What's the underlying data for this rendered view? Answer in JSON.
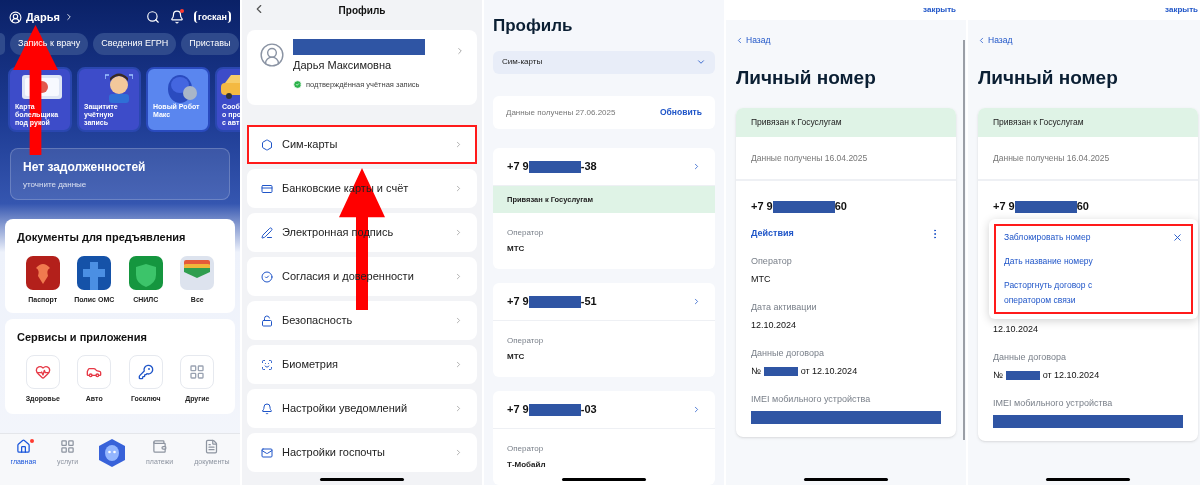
{
  "home": {
    "user": "Дарья",
    "scan": "госкан",
    "chips": [
      "Запись к врачу",
      "Сведения ЕГРН",
      "Приставы"
    ],
    "banners": [
      {
        "kind": "card",
        "lines": [
          "Карта",
          "болельщика",
          "под рукой"
        ]
      },
      {
        "kind": "person",
        "lines": [
          "Защитите",
          "учётную",
          "запись"
        ]
      },
      {
        "kind": "robot",
        "lines": [
          "Новый Робот",
          "Макс"
        ]
      },
      {
        "kind": "car",
        "lines": [
          "Сооб",
          "о про",
          "с авт"
        ]
      }
    ],
    "debt": {
      "title": "Нет задолженностей",
      "subtitle": "уточните данные"
    },
    "documents": {
      "title": "Документы для предъявления",
      "items": [
        {
          "kind": "passport",
          "label": "Паспорт"
        },
        {
          "kind": "oms",
          "label": "Полис ОМС"
        },
        {
          "kind": "snils",
          "label": "СНИЛС"
        },
        {
          "kind": "all",
          "label": "Все"
        }
      ]
    },
    "services": {
      "title": "Сервисы и приложения",
      "items": [
        {
          "kind": "health",
          "label": "Здоровье"
        },
        {
          "kind": "auto",
          "label": "Авто"
        },
        {
          "kind": "key",
          "label": "Госключ"
        },
        {
          "kind": "more",
          "label": "Другие"
        }
      ]
    },
    "nav": [
      {
        "kind": "home",
        "label": "главная",
        "selected": true
      },
      {
        "kind": "services",
        "label": "услуги",
        "selected": false
      },
      {
        "kind": "assistant",
        "selected": false
      },
      {
        "kind": "payments",
        "label": "платежи",
        "selected": false
      },
      {
        "kind": "documents",
        "label": "документы",
        "selected": false
      }
    ]
  },
  "profile": {
    "title": "Профиль",
    "name": "Дарья Максимовна",
    "status": "подтверждённая учётная запись",
    "items": [
      {
        "kind": "sim",
        "label": "Сим-карты",
        "highlighted": true
      },
      {
        "kind": "card",
        "label": "Банковские карты и счёт",
        "highlighted": false
      },
      {
        "kind": "sign",
        "label": "Электронная подпись",
        "highlighted": false
      },
      {
        "kind": "consent",
        "label": "Согласия и доверенности",
        "highlighted": false
      },
      {
        "kind": "lock",
        "label": "Безопасность",
        "highlighted": false
      },
      {
        "kind": "biometry",
        "label": "Биометрия",
        "highlighted": false
      },
      {
        "kind": "bell",
        "label": "Настройки уведомлений",
        "highlighted": false
      },
      {
        "kind": "mail",
        "label": "Настройки госпочты",
        "highlighted": false
      }
    ]
  },
  "sim_list": {
    "title": "Профиль",
    "select": "Сим-карты",
    "received": "Данные получены 27.06.2025",
    "refresh": "Обновить",
    "sims": [
      {
        "prefix": "+7 9",
        "suffix": "-38",
        "linked": "Привязан к Госуслугам",
        "operator_label": "Оператор",
        "operator": "МТС"
      },
      {
        "prefix": "+7 9",
        "suffix": "-51",
        "operator_label": "Оператор",
        "operator": "МТС"
      },
      {
        "prefix": "+7 9",
        "suffix": "-03",
        "operator_label": "Оператор",
        "operator": "Т-Мобайл"
      }
    ]
  },
  "number_detail": {
    "close": "закрыть",
    "back": "Назад",
    "title": "Личный номер",
    "linked": "Привязан к Госуслугам",
    "received": "Данные получены 16.04.2025",
    "prefix": "+7 9",
    "suffix": "60",
    "actions": "Действия",
    "fields": [
      {
        "kind": "text",
        "label": "Оператор",
        "value": "МТС"
      },
      {
        "kind": "text",
        "label": "Дата активации",
        "value": "12.10.2024"
      },
      {
        "kind": "contract",
        "label": "Данные договора",
        "prefix": "№",
        "value": "от 12.10.2024"
      },
      {
        "kind": "redacted",
        "label": "IMEI мобильного устройства"
      }
    ]
  },
  "number_menu": {
    "close": "закрыть",
    "back": "Назад",
    "title": "Личный номер",
    "linked": "Привязан к Госуслугам",
    "received": "Данные получены 16.04.2025",
    "prefix": "+7 9",
    "suffix": "60",
    "menu": {
      "highlighted": true,
      "items": [
        "Заблокировать номер",
        "Дать название номеру",
        "Расторгнуть договор с оператором связи"
      ]
    },
    "activation_value": "12.10.2024",
    "fields": [
      {
        "kind": "contract",
        "label": "Данные договора",
        "prefix": "№",
        "value": "от 12.10.2024"
      },
      {
        "kind": "redacted",
        "label": "IMEI мобильного устройства"
      }
    ]
  }
}
